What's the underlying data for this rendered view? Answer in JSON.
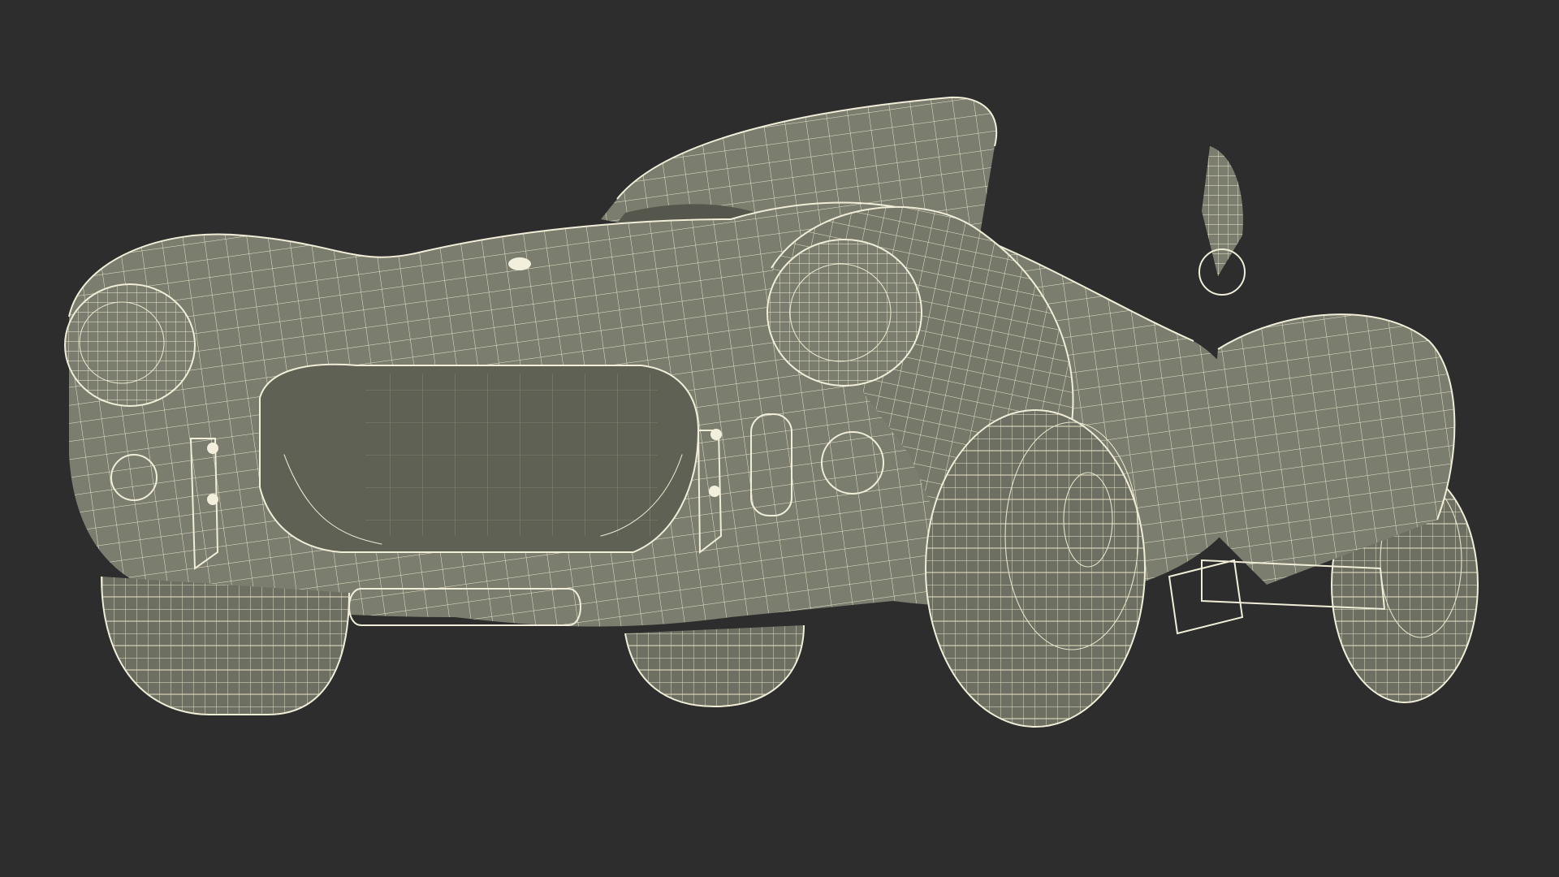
{
  "scene": {
    "subject": "sports-car-wireframe",
    "render_style": "wireframe",
    "colors": {
      "background": "#2d2d2d",
      "surface": "#7b7d6e",
      "wire": "#e6e4cc"
    },
    "icons": [
      "car-body-icon",
      "headlight-icon",
      "wheel-icon",
      "windshield-icon"
    ]
  }
}
